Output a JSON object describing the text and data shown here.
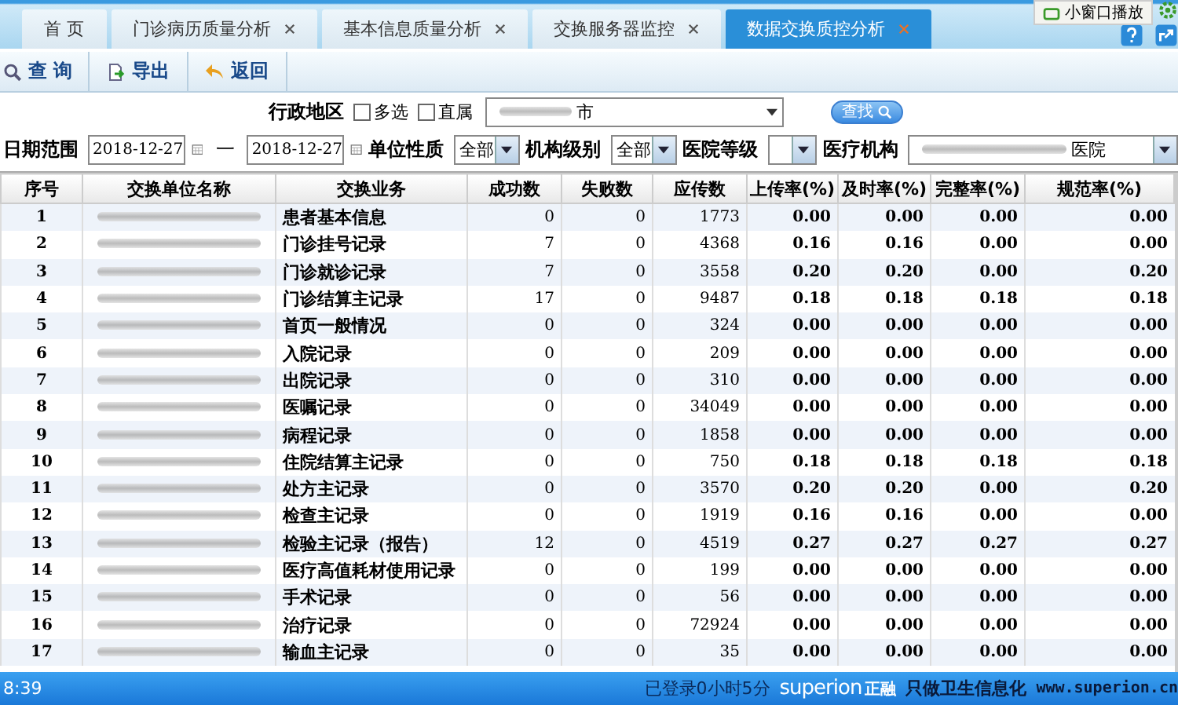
{
  "tabs": [
    {
      "label": "首 页",
      "closable": false,
      "selected": false
    },
    {
      "label": "门诊病历质量分析",
      "closable": true,
      "selected": false
    },
    {
      "label": "基本信息质量分析",
      "closable": true,
      "selected": false
    },
    {
      "label": "交换服务器监控",
      "closable": true,
      "selected": false
    },
    {
      "label": "数据交换质控分析",
      "closable": true,
      "selected": true
    }
  ],
  "popout": {
    "label": "小窗口播放"
  },
  "toolbar": [
    {
      "kind": "search",
      "label": "查 询"
    },
    {
      "kind": "export",
      "label": "导出"
    },
    {
      "kind": "back",
      "label": "返回"
    }
  ],
  "region": {
    "label": "行政地区",
    "options": [
      {
        "label": "多选",
        "checked": false
      },
      {
        "label": "直属",
        "checked": false
      }
    ],
    "value": "市",
    "search_button": "查找"
  },
  "filters": {
    "date_label": "日期范围",
    "date_from": "2018-12-27",
    "date_sep": "一",
    "date_to": "2018-12-27",
    "selects": [
      {
        "label": "单位性质",
        "value": "全部",
        "kind": "short"
      },
      {
        "label": "机构级别",
        "value": "全部",
        "kind": "short"
      },
      {
        "label": "医院等级",
        "kind": "short"
      },
      {
        "label": "医疗机构",
        "value": "医院",
        "kind": "wide"
      }
    ]
  },
  "table": {
    "columns": [
      "序号",
      "交换单位名称",
      "交换业务",
      "成功数",
      "失败数",
      "应传数",
      "上传率(%)",
      "及时率(%)",
      "完整率(%)",
      "规范率(%)"
    ],
    "rows": [
      [
        "1",
        "",
        "患者基本信息",
        "0",
        "0",
        "1773",
        "0.00",
        "0.00",
        "0.00",
        "0.00"
      ],
      [
        "2",
        "",
        "门诊挂号记录",
        "7",
        "0",
        "4368",
        "0.16",
        "0.16",
        "0.00",
        "0.00"
      ],
      [
        "3",
        "",
        "门诊就诊记录",
        "7",
        "0",
        "3558",
        "0.20",
        "0.20",
        "0.00",
        "0.20"
      ],
      [
        "4",
        "",
        "门诊结算主记录",
        "17",
        "0",
        "9487",
        "0.18",
        "0.18",
        "0.18",
        "0.18"
      ],
      [
        "5",
        "",
        "首页一般情况",
        "0",
        "0",
        "324",
        "0.00",
        "0.00",
        "0.00",
        "0.00"
      ],
      [
        "6",
        "",
        "入院记录",
        "0",
        "0",
        "209",
        "0.00",
        "0.00",
        "0.00",
        "0.00"
      ],
      [
        "7",
        "",
        "出院记录",
        "0",
        "0",
        "310",
        "0.00",
        "0.00",
        "0.00",
        "0.00"
      ],
      [
        "8",
        "",
        "医嘱记录",
        "0",
        "0",
        "34049",
        "0.00",
        "0.00",
        "0.00",
        "0.00"
      ],
      [
        "9",
        "",
        "病程记录",
        "0",
        "0",
        "1858",
        "0.00",
        "0.00",
        "0.00",
        "0.00"
      ],
      [
        "10",
        "",
        "住院结算主记录",
        "0",
        "0",
        "750",
        "0.18",
        "0.18",
        "0.18",
        "0.18"
      ],
      [
        "11",
        "",
        "处方主记录",
        "0",
        "0",
        "3570",
        "0.20",
        "0.20",
        "0.00",
        "0.20"
      ],
      [
        "12",
        "",
        "检查主记录",
        "0",
        "0",
        "1919",
        "0.16",
        "0.16",
        "0.00",
        "0.00"
      ],
      [
        "13",
        "",
        "检验主记录（报告）",
        "12",
        "0",
        "4519",
        "0.27",
        "0.27",
        "0.27",
        "0.27"
      ],
      [
        "14",
        "",
        "医疗高值耗材使用记录",
        "0",
        "0",
        "199",
        "0.00",
        "0.00",
        "0.00",
        "0.00"
      ],
      [
        "15",
        "",
        "手术记录",
        "0",
        "0",
        "56",
        "0.00",
        "0.00",
        "0.00",
        "0.00"
      ],
      [
        "16",
        "",
        "治疗记录",
        "0",
        "0",
        "72924",
        "0.00",
        "0.00",
        "0.00",
        "0.00"
      ],
      [
        "17",
        "",
        "输血主记录",
        "0",
        "0",
        "35",
        "0.00",
        "0.00",
        "0.00",
        "0.00"
      ]
    ]
  },
  "status_bar": {
    "time": "8:39",
    "session": "已登录0小时5分",
    "brand": "superion",
    "brand_cn": "正融",
    "slogan": "只做卫生信息化",
    "url": "www.superion.cn"
  }
}
